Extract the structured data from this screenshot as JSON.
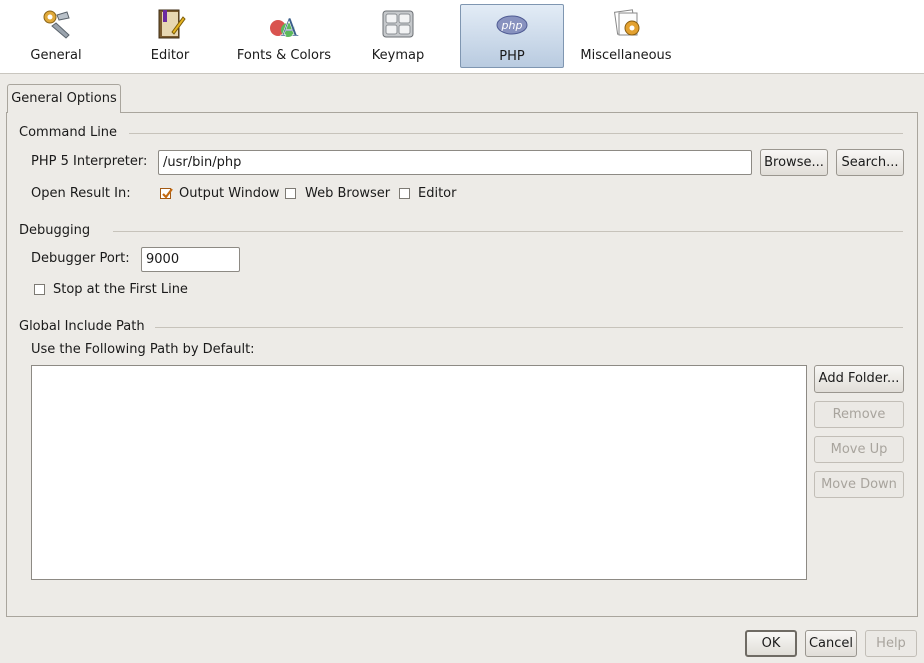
{
  "toolbar": {
    "categories": [
      {
        "label": "General",
        "icon": "tools-icon"
      },
      {
        "label": "Editor",
        "icon": "editor-book-icon"
      },
      {
        "label": "Fonts & Colors",
        "icon": "fonts-colors-icon"
      },
      {
        "label": "Keymap",
        "icon": "keymap-icon"
      },
      {
        "label": "PHP",
        "icon": "php-icon",
        "selected": true
      },
      {
        "label": "Miscellaneous",
        "icon": "miscellaneous-icon"
      }
    ]
  },
  "tab": {
    "label": "General Options"
  },
  "command_line": {
    "header": "Command Line",
    "interpreter_label": "PHP 5 Interpreter:",
    "interpreter_value": "/usr/bin/php",
    "browse_label": "Browse...",
    "search_label": "Search...",
    "open_result_label": "Open Result In:",
    "options": [
      {
        "label": "Output Window",
        "checked": true
      },
      {
        "label": "Web Browser",
        "checked": false
      },
      {
        "label": "Editor",
        "checked": false
      }
    ]
  },
  "debugging": {
    "header": "Debugging",
    "port_label": "Debugger Port:",
    "port_value": "9000",
    "stop_first_line_label": "Stop at the First Line",
    "stop_first_line_checked": false
  },
  "include_path": {
    "header": "Global Include Path",
    "default_label": "Use the Following Path by Default:",
    "add_folder_label": "Add Folder...",
    "remove_label": "Remove",
    "move_up_label": "Move Up",
    "move_down_label": "Move Down"
  },
  "footer": {
    "ok_label": "OK",
    "cancel_label": "Cancel",
    "help_label": "Help"
  },
  "colors": {
    "selected_category": "#b9cbe0",
    "checkbox_check": "#c46a12"
  }
}
